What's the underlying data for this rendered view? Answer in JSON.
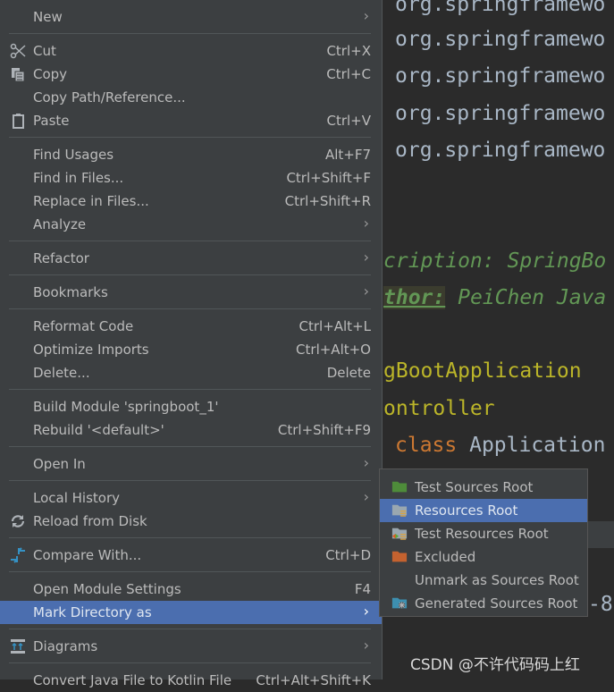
{
  "editor": {
    "imports": [
      "org.springframewo",
      "org.springframewo",
      "org.springframewo",
      "org.springframewo",
      "org.springframewo"
    ],
    "doc_description": "cription: SpringBo",
    "doc_author_tag": "thor:",
    "doc_author": " PeiChen Java",
    "annotation1": "gBootApplication",
    "annotation2": "ontroller",
    "class_kw": "class",
    "class_name": " Application",
    "partial": "-8"
  },
  "menu": {
    "items": [
      {
        "label": "New",
        "arrow": true
      },
      {
        "sep": true
      },
      {
        "label": "Cut",
        "shortcut": "Ctrl+X",
        "icon": "scissors-icon"
      },
      {
        "label": "Copy",
        "shortcut": "Ctrl+C",
        "icon": "copy-icon"
      },
      {
        "label": "Copy Path/Reference..."
      },
      {
        "label": "Paste",
        "shortcut": "Ctrl+V",
        "icon": "clipboard-icon"
      },
      {
        "sep": true
      },
      {
        "label": "Find Usages",
        "shortcut": "Alt+F7"
      },
      {
        "label": "Find in Files...",
        "shortcut": "Ctrl+Shift+F"
      },
      {
        "label": "Replace in Files...",
        "shortcut": "Ctrl+Shift+R"
      },
      {
        "label": "Analyze",
        "arrow": true
      },
      {
        "sep": true
      },
      {
        "label": "Refactor",
        "arrow": true
      },
      {
        "sep": true
      },
      {
        "label": "Bookmarks",
        "arrow": true
      },
      {
        "sep": true
      },
      {
        "label": "Reformat Code",
        "shortcut": "Ctrl+Alt+L"
      },
      {
        "label": "Optimize Imports",
        "shortcut": "Ctrl+Alt+O"
      },
      {
        "label": "Delete...",
        "shortcut": "Delete"
      },
      {
        "sep": true
      },
      {
        "label": "Build Module 'springboot_1'"
      },
      {
        "label": "Rebuild '<default>'",
        "shortcut": "Ctrl+Shift+F9"
      },
      {
        "sep": true
      },
      {
        "label": "Open In",
        "arrow": true
      },
      {
        "sep": true
      },
      {
        "label": "Local History",
        "arrow": true
      },
      {
        "label": "Reload from Disk",
        "icon": "reload-icon"
      },
      {
        "sep": true
      },
      {
        "label": "Compare With...",
        "shortcut": "Ctrl+D",
        "icon": "compare-icon"
      },
      {
        "sep": true
      },
      {
        "label": "Open Module Settings",
        "shortcut": "F4"
      },
      {
        "label": "Mark Directory as",
        "arrow": true,
        "selected": true
      },
      {
        "sep": true
      },
      {
        "label": "Diagrams",
        "arrow": true,
        "icon": "diagram-icon"
      },
      {
        "sep": true
      },
      {
        "label": "Convert Java File to Kotlin File",
        "shortcut": "Ctrl+Alt+Shift+K"
      }
    ]
  },
  "submenu": {
    "items": [
      {
        "label": "Test Sources Root",
        "icon": "test-sources-folder-icon",
        "color": "#4e8c3a"
      },
      {
        "label": "Resources Root",
        "icon": "resources-folder-icon",
        "color": "#9aa7b0",
        "selected": true
      },
      {
        "label": "Test Resources Root",
        "icon": "test-resources-folder-icon",
        "color": "#9aa7b0"
      },
      {
        "label": "Excluded",
        "icon": "excluded-folder-icon",
        "color": "#c4622f"
      },
      {
        "label": "Unmark as Sources Root"
      },
      {
        "label": "Generated Sources Root",
        "icon": "generated-sources-folder-icon",
        "color": "#3d8fb0"
      }
    ]
  },
  "watermark": "CSDN @不许代码码上红",
  "arrow_glyph": "›"
}
